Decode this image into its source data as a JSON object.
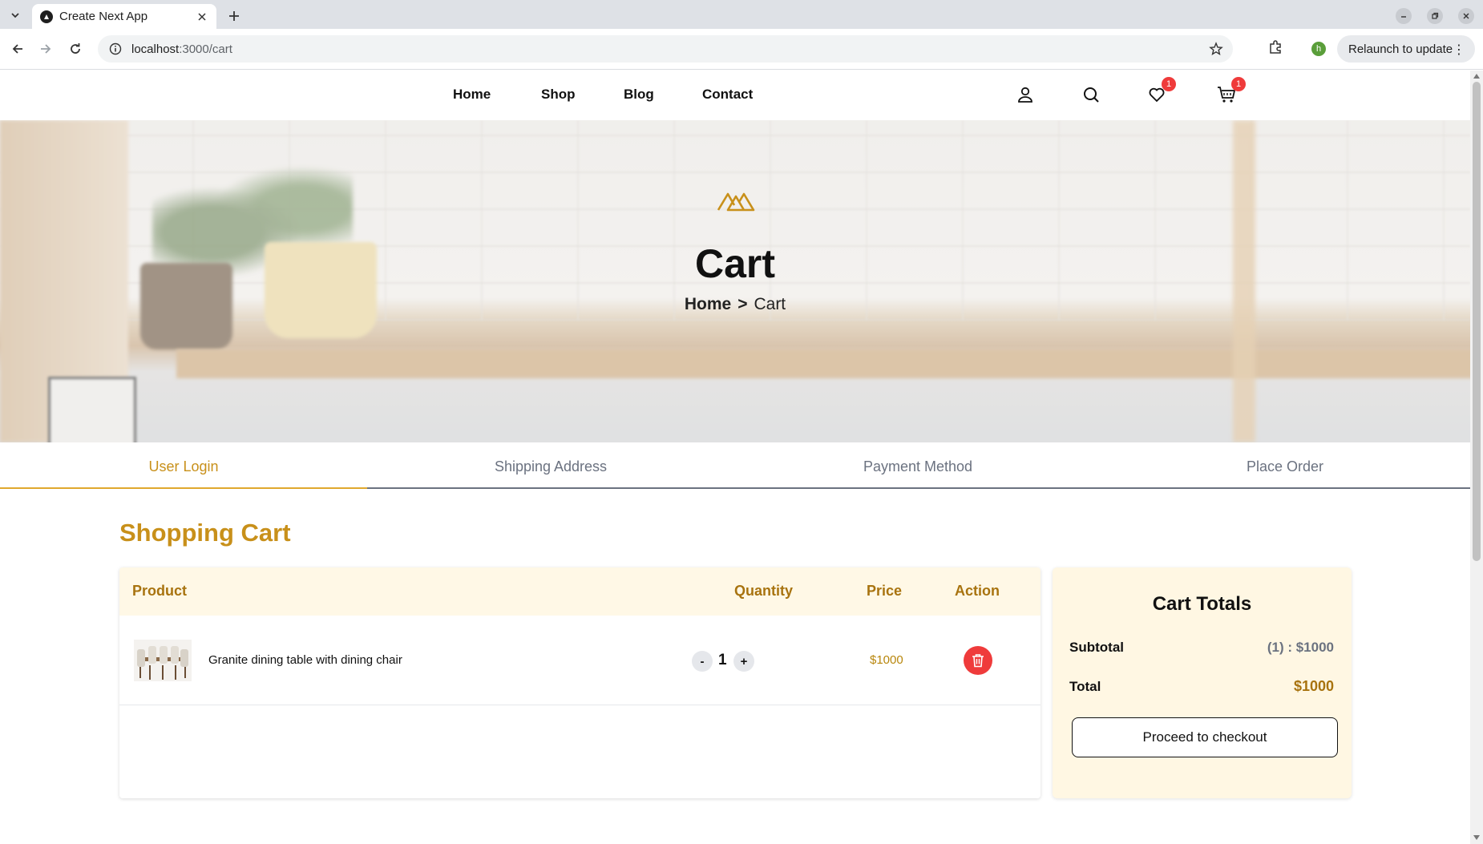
{
  "browser": {
    "tab_title": "Create Next App",
    "url_host": "localhost",
    "url_path": ":3000/cart",
    "profile_initial": "h",
    "relaunch_label": "Relaunch to update"
  },
  "nav": {
    "links": [
      "Home",
      "Shop",
      "Blog",
      "Contact"
    ],
    "wishlist_count": "1",
    "cart_count": "1"
  },
  "hero": {
    "title": "Cart",
    "breadcrumb_home": "Home",
    "breadcrumb_sep": ">",
    "breadcrumb_current": "Cart"
  },
  "steps": [
    "User Login",
    "Shipping Address",
    "Payment Method",
    "Place Order"
  ],
  "cart": {
    "heading": "Shopping Cart",
    "columns": {
      "product": "Product",
      "quantity": "Quantity",
      "price": "Price",
      "action": "Action"
    },
    "items": [
      {
        "name": "Granite dining table with dining chair",
        "quantity": "1",
        "price": "$1000",
        "minus": "-",
        "plus": "+"
      }
    ]
  },
  "totals": {
    "title": "Cart Totals",
    "subtotal_label": "Subtotal",
    "subtotal_value": "(1) : $1000",
    "total_label": "Total",
    "total_value": "$1000",
    "checkout_label": "Proceed to checkout"
  },
  "colors": {
    "accent": "#c8901a",
    "header_bg": "#fff8e6",
    "danger": "#ef3b3b"
  }
}
